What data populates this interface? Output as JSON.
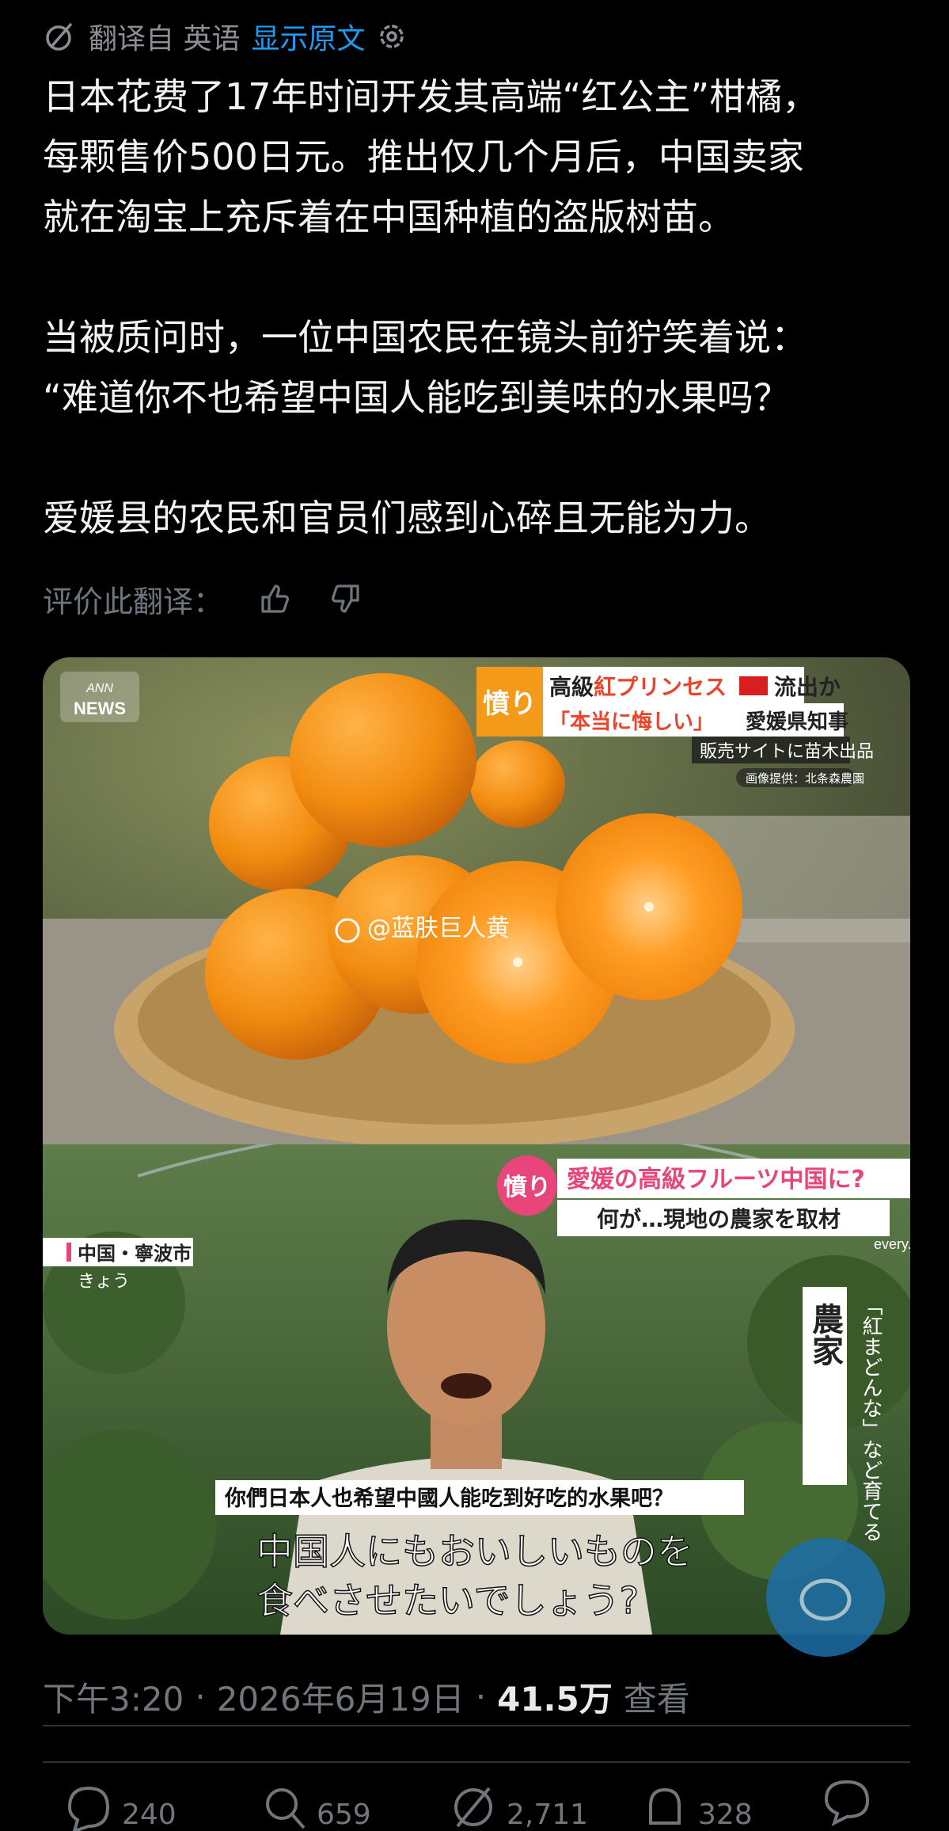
{
  "translate": {
    "source": "翻译自 英语",
    "show_original": "显示原文"
  },
  "post": {
    "text": "日本花费了17年时间开发其高端“红公主”柑橘，\n每颗售价500日元。推出仅几个月后，中国卖家\n就在淘宝上充斥着在中国种植的盗版树苗。\n\n当被质问时，一位中国农民在镜头前狞笑着说：\n“难道你不也希望中国人能吃到美味的水果吗？\n\n爱媛县的农民和官员们感到心碎且无能为力。"
  },
  "rate": {
    "label": "评价此翻译："
  },
  "media": {
    "top": {
      "logo_line1": "ANN",
      "logo_line2": "NEWS",
      "badge": "憤り",
      "headline1_prefix": "高級",
      "headline1_red": "紅プリンセス",
      "headline1_suffix": "流出か",
      "headline2_quote": "「本当に悔しい」",
      "headline2_suffix": "愛媛県知事",
      "sub1": "販売サイトに苗木出品",
      "sub2": "画像提供：北条森農園",
      "watermark": "@蓝肤巨人黄"
    },
    "bottom": {
      "badge": "憤り",
      "headline1": "愛媛の高級フルーツ中国に?",
      "headline2": "何が…現地の農家を取材",
      "every": "every.",
      "location": "中国・寧波市",
      "location_sub": "きょう",
      "side_main": "農家",
      "side_sub": "「紅まどんな」など育てる",
      "subtitle_zh": "你們日本人也希望中國人能吃到好吃的水果吧？",
      "subtitle_jp1": "中国人にもおいしいものを",
      "subtitle_jp2": "食べさせたいでしょう?"
    }
  },
  "meta": {
    "time": "下午3:20",
    "sep1": "·",
    "date": "2026年6月19日",
    "sep2": "·",
    "views": "41.5万",
    "views_label": "查看"
  },
  "actions": {
    "replies": "240",
    "reposts": "659",
    "likes": "2,711",
    "bookmarks": "328"
  },
  "colors": {
    "accent": "#1d9bf0",
    "badge_orange": "#f39a1a",
    "headline_red": "#e8452c",
    "pink": "#e8457a"
  }
}
